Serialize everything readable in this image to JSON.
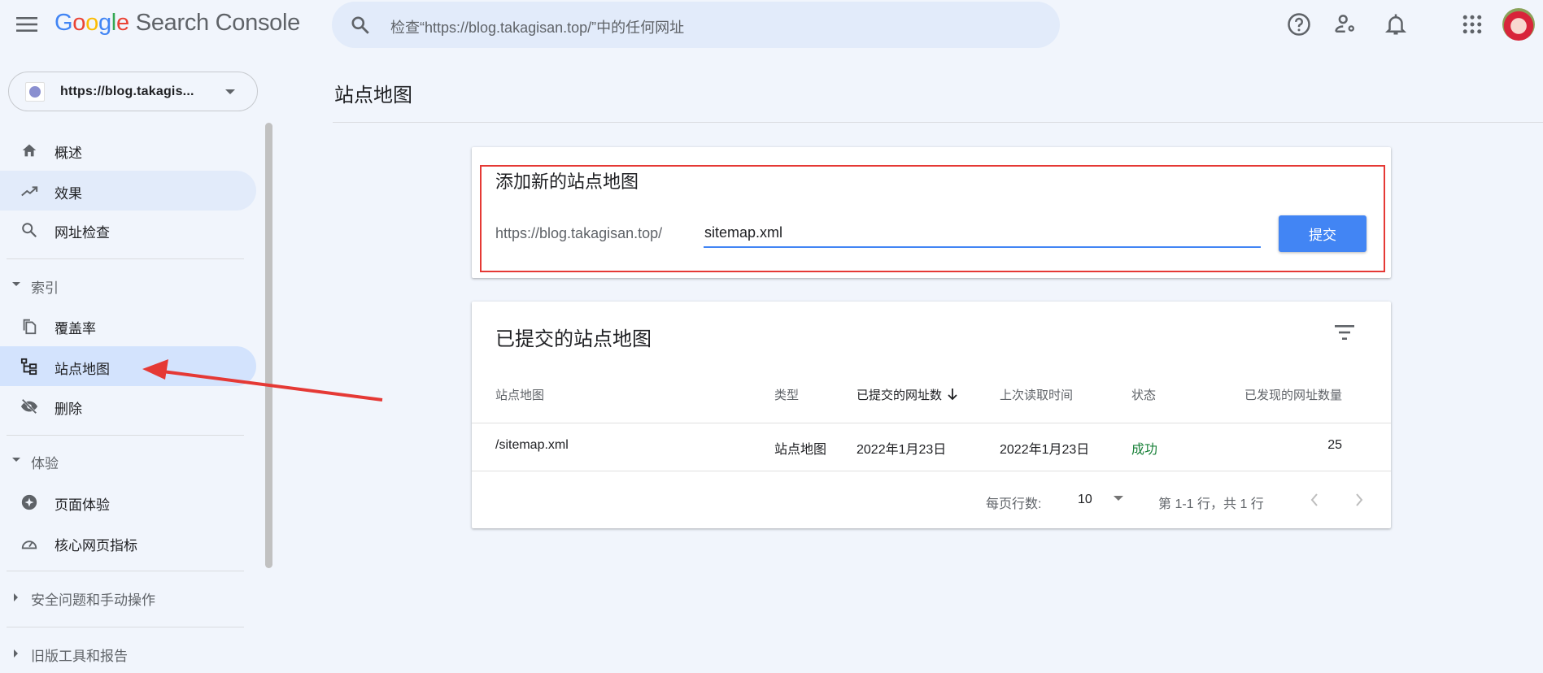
{
  "header": {
    "logo": {
      "g": "G",
      "o1": "o",
      "o2": "o",
      "g2": "g",
      "l": "l",
      "e": "e",
      "product": "Search Console"
    },
    "search_placeholder": "检查“https://blog.takagisan.top/”中的任何网址",
    "icons": [
      "menu-icon",
      "search-icon",
      "help-icon",
      "manage-users-icon",
      "notifications-icon",
      "apps-icon",
      "avatar"
    ]
  },
  "property": {
    "label": "https://blog.takagis..."
  },
  "sidebar": {
    "items": [
      {
        "label": "概述",
        "icon": "home-icon"
      },
      {
        "label": "效果",
        "icon": "trending-up-icon"
      },
      {
        "label": "网址检查",
        "icon": "search-icon"
      }
    ],
    "sections": [
      {
        "label": "索引",
        "expanded": true,
        "items": [
          {
            "label": "覆盖率",
            "icon": "copy-icon"
          },
          {
            "label": "站点地图",
            "icon": "sitemap-icon",
            "selected": true
          },
          {
            "label": "删除",
            "icon": "visibility-off-icon"
          }
        ]
      },
      {
        "label": "体验",
        "expanded": true,
        "items": [
          {
            "label": "页面体验",
            "icon": "page-experience-icon"
          },
          {
            "label": "核心网页指标",
            "icon": "speed-icon"
          }
        ]
      },
      {
        "label": "安全问题和手动操作",
        "expanded": false
      },
      {
        "label": "旧版工具和报告",
        "expanded": false
      }
    ]
  },
  "page": {
    "title": "站点地图"
  },
  "add_sitemap": {
    "title": "添加新的站点地图",
    "prefix": "https://blog.takagisan.top/",
    "input_value": "sitemap.xml",
    "submit_label": "提交"
  },
  "submitted": {
    "title": "已提交的站点地图",
    "columns": [
      "站点地图",
      "类型",
      "已提交的网址数",
      "上次读取时间",
      "状态",
      "已发现的网址数量"
    ],
    "sorted_column": "已提交的网址数",
    "rows": [
      {
        "sitemap": "/sitemap.xml",
        "type": "站点地图",
        "submitted": "2022年1月23日",
        "last_read": "2022年1月23日",
        "status": "成功",
        "discovered": "25"
      }
    ],
    "pagination": {
      "rows_per_page_label": "每页行数:",
      "rows_per_page": "10",
      "range": "第 1-1 行，共 1 行"
    }
  },
  "colors": {
    "accent": "#4285f4",
    "success": "#188038",
    "highlight_box": "#e53935",
    "annotation_arrow": "#e53935"
  }
}
